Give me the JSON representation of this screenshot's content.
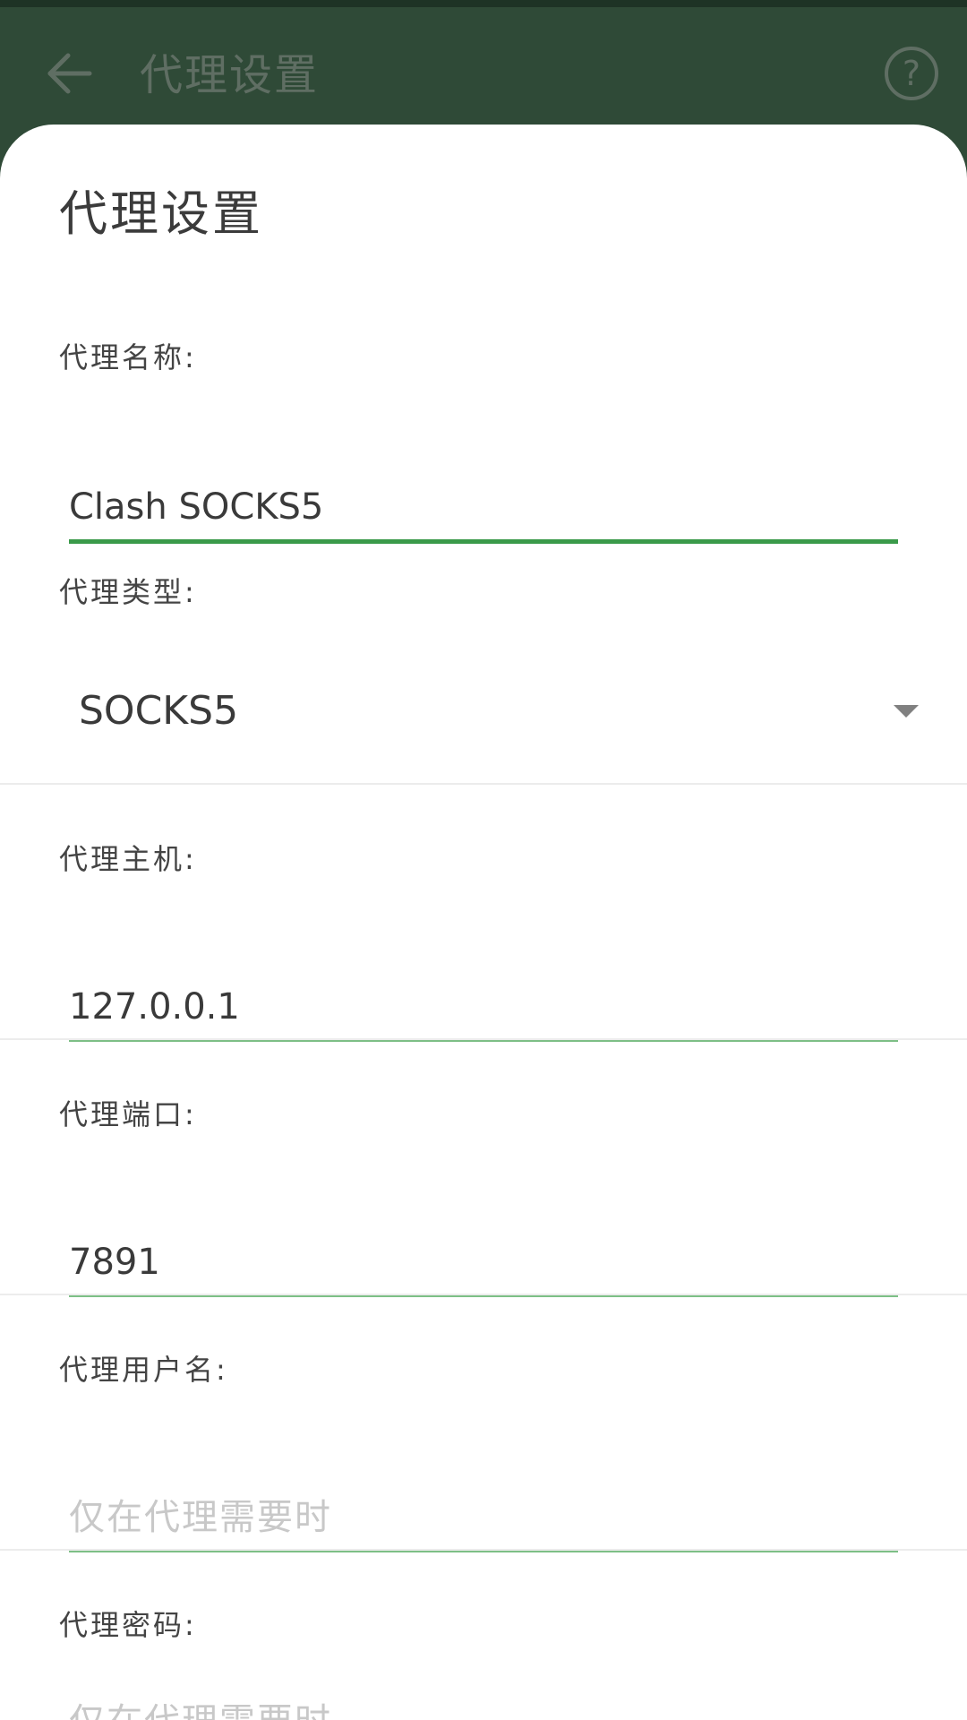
{
  "appbar": {
    "title": "代理设置",
    "back_icon": "arrow-back-icon",
    "help_icon": "help-circle-icon",
    "help_glyph": "?",
    "color": "#2f4a37"
  },
  "dialog": {
    "title": "代理设置",
    "accent_color": "#3a9a4a",
    "fields": {
      "name": {
        "label": "代理名称:",
        "value": "Clash SOCKS5"
      },
      "type": {
        "label": "代理类型:",
        "value": "SOCKS5"
      },
      "host": {
        "label": "代理主机:",
        "value": "127.0.0.1"
      },
      "port": {
        "label": "代理端口:",
        "value": "7891"
      },
      "username": {
        "label": "代理用户名:",
        "placeholder": "仅在代理需要时"
      },
      "password": {
        "label": "代理密码:",
        "placeholder": "仅在代理需要时"
      }
    }
  }
}
